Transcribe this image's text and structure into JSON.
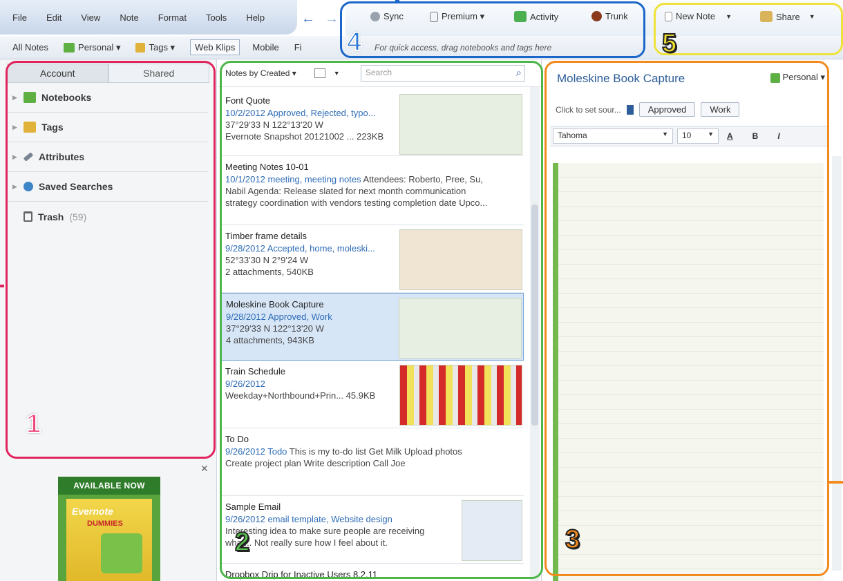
{
  "menu": [
    "File",
    "Edit",
    "View",
    "Note",
    "Format",
    "Tools",
    "Help"
  ],
  "toolbar_top": {
    "sync": "Sync",
    "premium": "Premium ▾",
    "activity": "Activity",
    "trunk": "Trunk",
    "new_note": "New Note",
    "share": "Share"
  },
  "toolbar2": {
    "all_notes": "All Notes",
    "personal": "Personal ▾",
    "tags": "Tags ▾",
    "web_clips": "Web Klips",
    "mobile": "Mobile",
    "fi": "Fi",
    "hint": "For quick access, drag notebooks and tags here"
  },
  "left": {
    "tabs": [
      "Account",
      "Shared"
    ],
    "items": [
      "Notebooks",
      "Tags",
      "Attributes",
      "Saved Searches"
    ],
    "trash": "Trash",
    "trash_count": "(59)"
  },
  "ad": {
    "banner": "AVAILABLE NOW",
    "brand": "Evernote",
    "sub": "DUMMIES"
  },
  "middle": {
    "sort": "Notes by Created ▾",
    "search_placeholder": "Search",
    "notes": [
      {
        "title": "Font Quote",
        "meta": "10/2/2012  Approved, Rejected, typo...",
        "l1": "37°29'33 N 122°13'20 W",
        "l2": "Evernote Snapshot 20121002 ...  223KB"
      },
      {
        "title": "Meeting Notes 10-01",
        "meta": "10/1/2012  meeting, meeting notes",
        "meta_rest": " Attendees: Roberto, Pree, Su,",
        "l1": "Nabil Agenda: Release slated for next month communication",
        "l2": "strategy coordination with vendors testing completion date Upco..."
      },
      {
        "title": "Timber frame details",
        "meta": "9/28/2012  Accepted, home, moleski...",
        "l1": "52°33'30 N 2°9'24 W",
        "l2": "2 attachments,  540KB"
      },
      {
        "title": "Moleskine Book Capture",
        "meta": "9/28/2012  Approved, Work",
        "l1": "37°29'33 N 122°13'20 W",
        "l2": "4 attachments,  943KB"
      },
      {
        "title": "Train Schedule",
        "meta": "9/26/2012",
        "l1": "Weekday+Northbound+Prin...  45.9KB",
        "l2": ""
      },
      {
        "title": "To Do",
        "meta": "9/26/2012  Todo",
        "meta_rest": "  This is my to-do list Get Milk Upload photos",
        "l1": "Create project plan Write description Call Joe",
        "l2": ""
      },
      {
        "title": "Sample Email",
        "meta": "9/26/2012  email template, Website design",
        "l1": "Interesting idea to make sure people are receiving",
        "l2": "what... Not really sure how I feel about it."
      },
      {
        "title": "Dropbox Drip for Inactive Users 8.2.11",
        "meta": "",
        "l1": "",
        "l2": ""
      }
    ]
  },
  "right": {
    "title": "Moleskine Book Capture",
    "notebook": "Personal ▾",
    "source": "Click to set sour...",
    "tags": [
      "Approved",
      "Work"
    ],
    "font": "Tahoma",
    "size": "10"
  },
  "annotations": [
    "1",
    "2",
    "3",
    "4",
    "5"
  ],
  "colors": {
    "frame1": "#e0245e",
    "frame2": "#4cb648",
    "frame3": "#f28a1e",
    "frame4": "#1b66c9",
    "frame5": "#efe23b"
  }
}
